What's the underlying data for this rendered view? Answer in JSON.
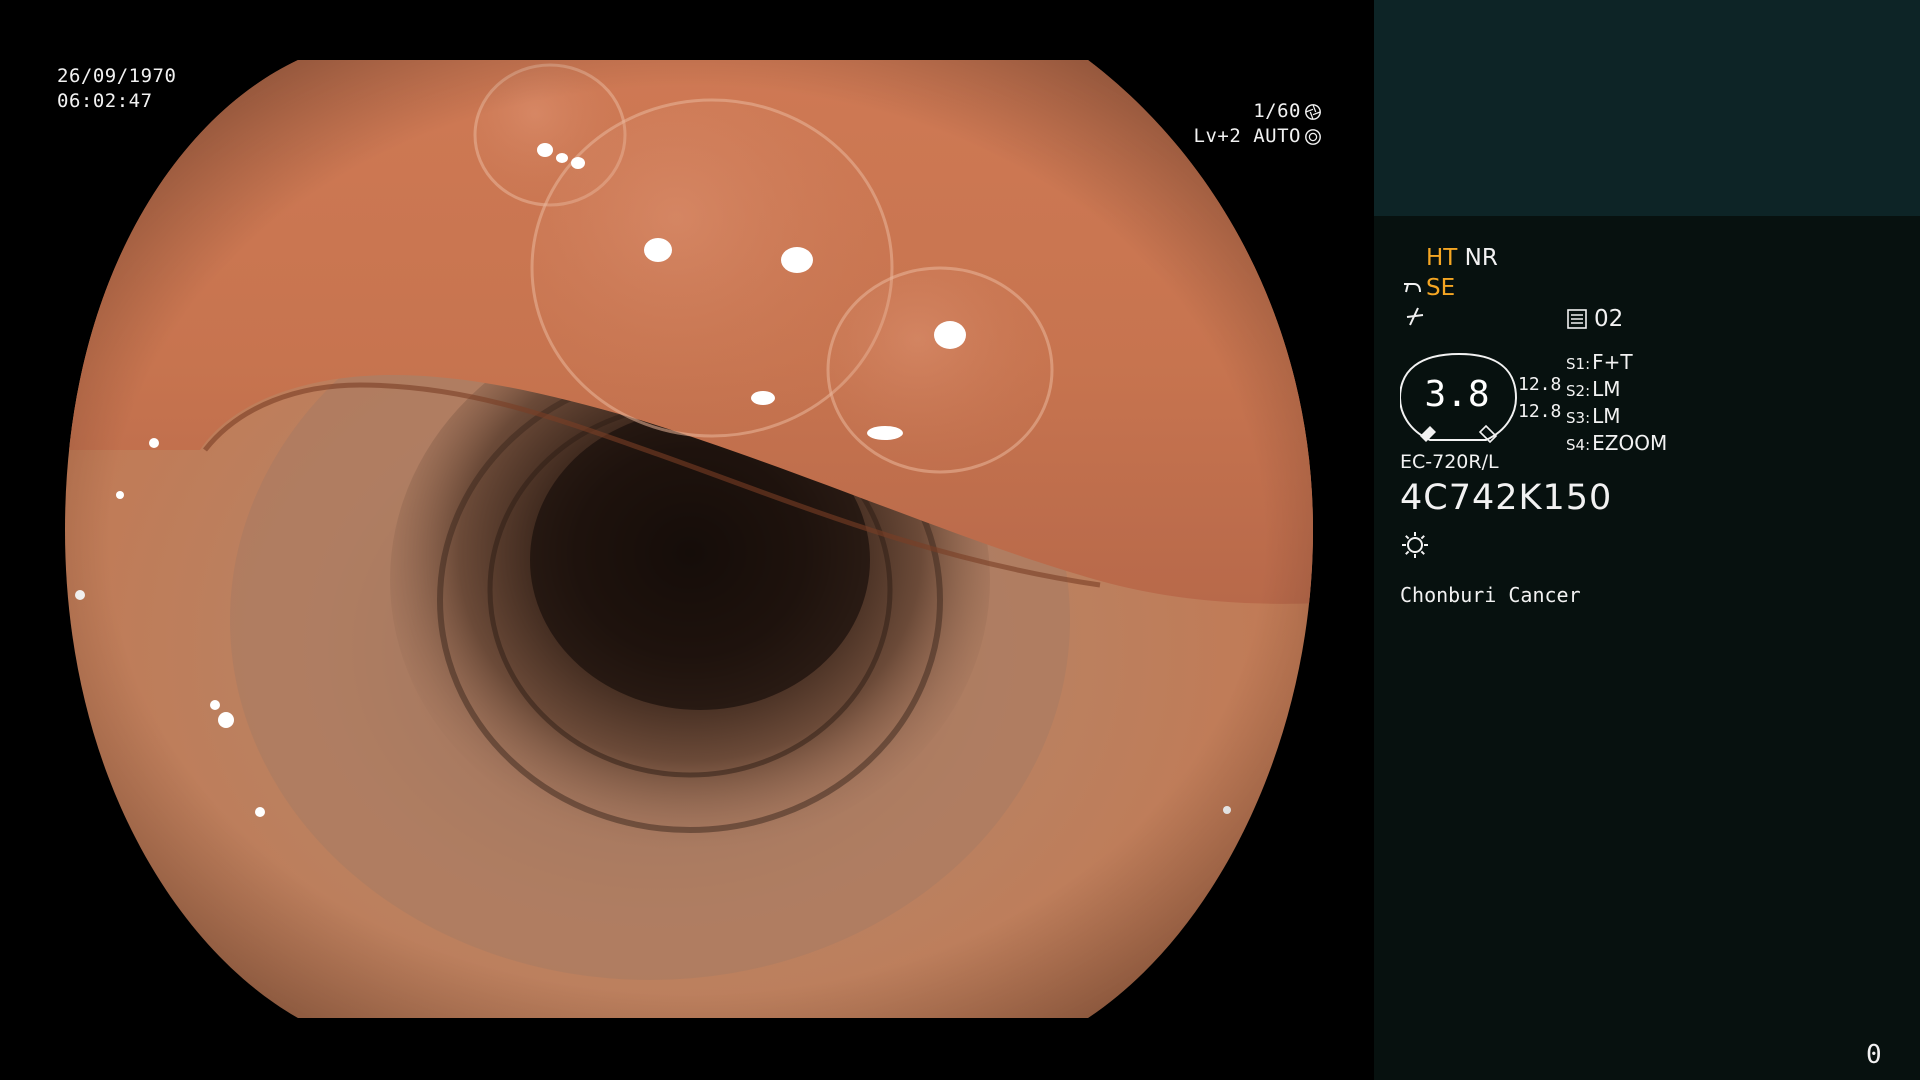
{
  "overlay": {
    "date": "26/09/1970",
    "time": "06:02:47",
    "shutter": "1/60",
    "level": "Lv+2 AUTO"
  },
  "panel": {
    "ht": "HT",
    "nr": "NR",
    "se": "SE",
    "memory": "02",
    "gauge_value": "3.8",
    "gauge_nums": [
      "12.8",
      "12.8"
    ],
    "switches": [
      {
        "key": "S1:",
        "value": "F+T"
      },
      {
        "key": "S2:",
        "value": "LM"
      },
      {
        "key": "S3:",
        "value": "LM"
      },
      {
        "key": "S4:",
        "value": "EZOOM"
      }
    ],
    "model": "EC-720R/L",
    "serial": "4C742K150",
    "institution": "Chonburi Cancer",
    "counter": "0"
  },
  "colors": {
    "accent": "#f5a623",
    "panel_top": "#0d2426",
    "panel_bg": "#07110f",
    "mucosa": "#c9825e"
  },
  "icons": {
    "shutter": "aperture-icon",
    "auto": "iris-icon",
    "se": "scope-tip-icon",
    "sharp": "sharpness-icon",
    "memory": "memory-card-icon",
    "light": "light-source-icon"
  }
}
